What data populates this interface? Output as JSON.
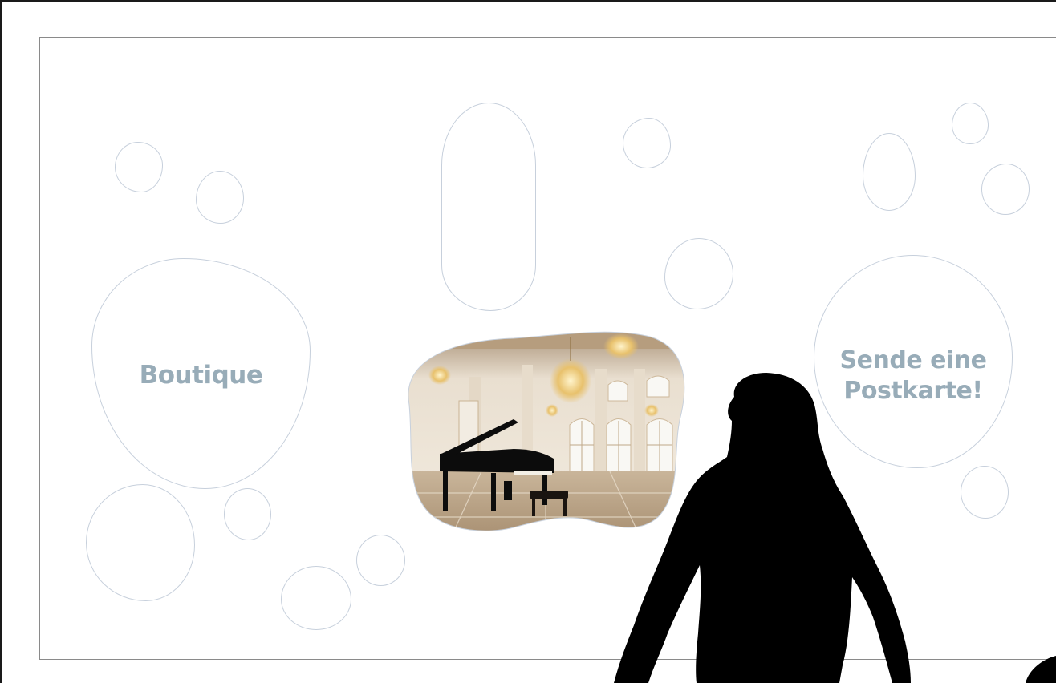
{
  "menu": {
    "boutique_label": "Boutique",
    "postcard_label_line1": "Sende eine",
    "postcard_label_line2": "Postkarte!"
  },
  "featured_image": {
    "subject": "ballroom-with-grand-piano"
  },
  "colors": {
    "label_text": "#98acb8",
    "bubble_outline": "#c7d0dc",
    "frame": "#8a8a8a",
    "silhouette": "#000000"
  }
}
